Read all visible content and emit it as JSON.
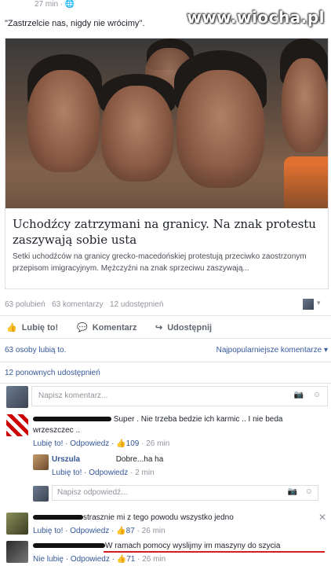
{
  "header": {
    "time": "27 min",
    "quote": "\"Zastrzelcie nas, nigdy nie wrócimy\".",
    "watermark": "www.wiocha.pl"
  },
  "article": {
    "title": "Uchodźcy zatrzymani na granicy. Na znak protestu zaszywają sobie usta",
    "description": "Setki uchodźców na granicy grecko-macedońskiej protestują przeciwko zaostrzonym przepisom imigracyjnym. Mężczyźni na znak sprzeciwu zaszywają..."
  },
  "stats": {
    "likes": "63 polubień",
    "comments": "63 komentarzy",
    "shares": "12 udostępnień"
  },
  "actions": {
    "like": "Lubię to!",
    "comment": "Komentarz",
    "share": "Udostępnij"
  },
  "likes_line": {
    "text": "63 osoby lubią to.",
    "sort": "Najpopularniejsze komentarze"
  },
  "shares_line": "12 ponownych udostępnień",
  "composer": {
    "placeholder": "Napisz komentarz..."
  },
  "comments": [
    {
      "text": "Super . Nie trzeba bedzie ich karmic .. I nie beda wrzeszczec ..",
      "like": "Lubię to!",
      "reply": "Odpowiedz",
      "count": "109",
      "time": "26 min"
    },
    {
      "author": "Urszula",
      "text": "Dobre...ha ha",
      "like": "Lubię to!",
      "reply": "Odpowiedz",
      "time": "2 min"
    },
    {
      "text": "strasznie mi z tego powodu wszystko jedno",
      "like": "Lubię to!",
      "reply": "Odpowiedz",
      "count": "87",
      "time": "26 min"
    },
    {
      "text": "W ramach pomocy wyslijmy im maszyny do szycia",
      "like": "Nie lubię",
      "reply": "Odpowiedz",
      "count": "71",
      "time": "26 min"
    }
  ],
  "reply_box": {
    "placeholder": "Napisz odpowiedź..."
  },
  "colors": {
    "link": "#365899",
    "underline": "#d62020"
  }
}
